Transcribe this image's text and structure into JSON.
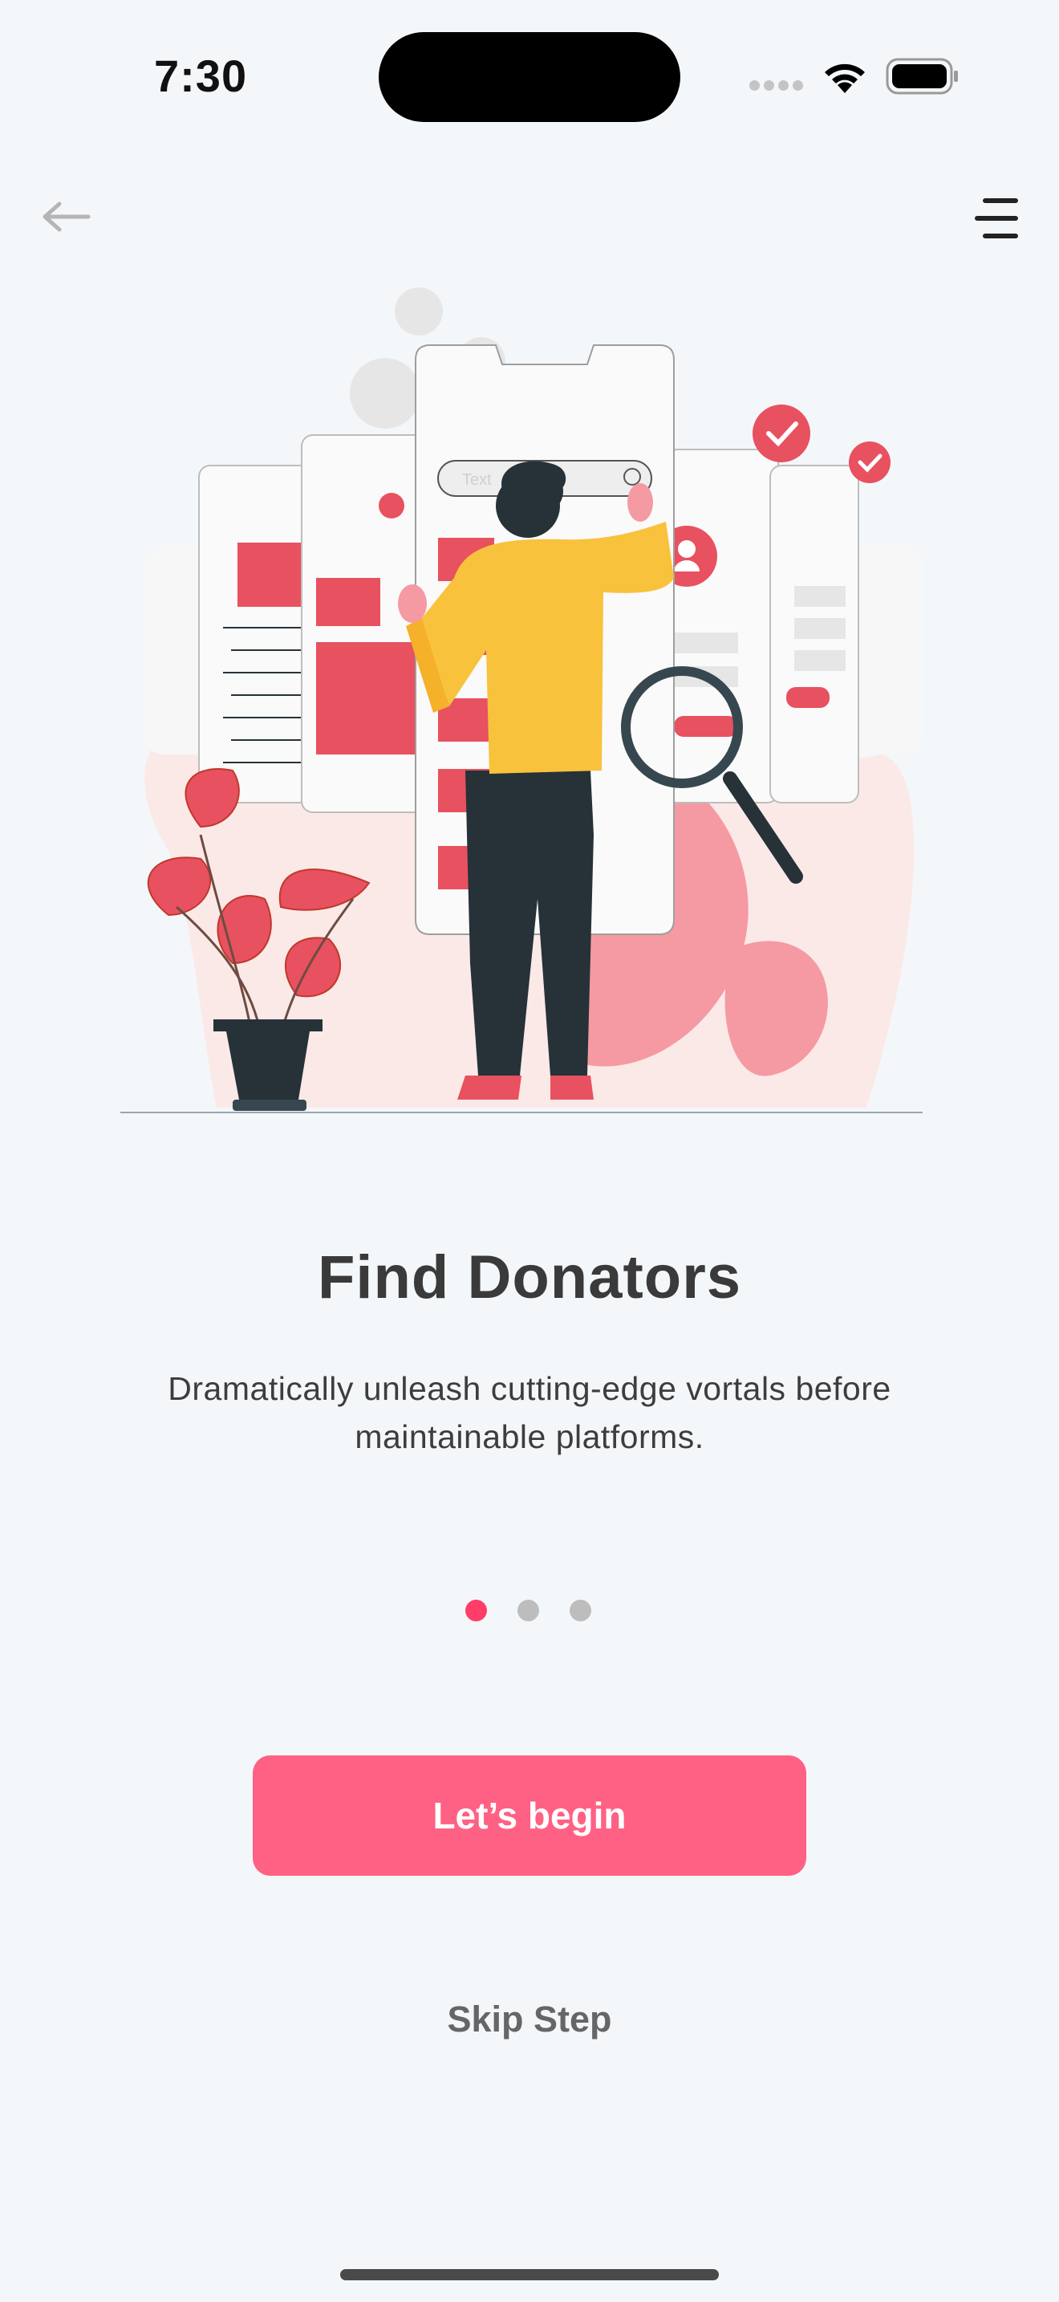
{
  "status_bar": {
    "time": "7:30"
  },
  "nav": {
    "back_icon": "arrow-left-icon",
    "menu_icon": "menu-icon"
  },
  "illustration": {
    "search_placeholder": "Text",
    "colors": {
      "accent": "#e8515f",
      "pink_blob": "#f59aa2",
      "shirt": "#f9c23c",
      "pants": "#263238"
    }
  },
  "onboarding": {
    "title": "Find Donators",
    "subtitle": "Dramatically unleash cutting-edge vortals before maintainable platforms.",
    "page_count": 3,
    "active_page": 1
  },
  "actions": {
    "primary_label": "Let’s begin",
    "skip_label": "Skip Step"
  },
  "colors": {
    "primary": "#ff6184",
    "dot_active": "#ff3d69",
    "dot_inactive": "#bdbdbd",
    "background": "#f4f7fa"
  }
}
